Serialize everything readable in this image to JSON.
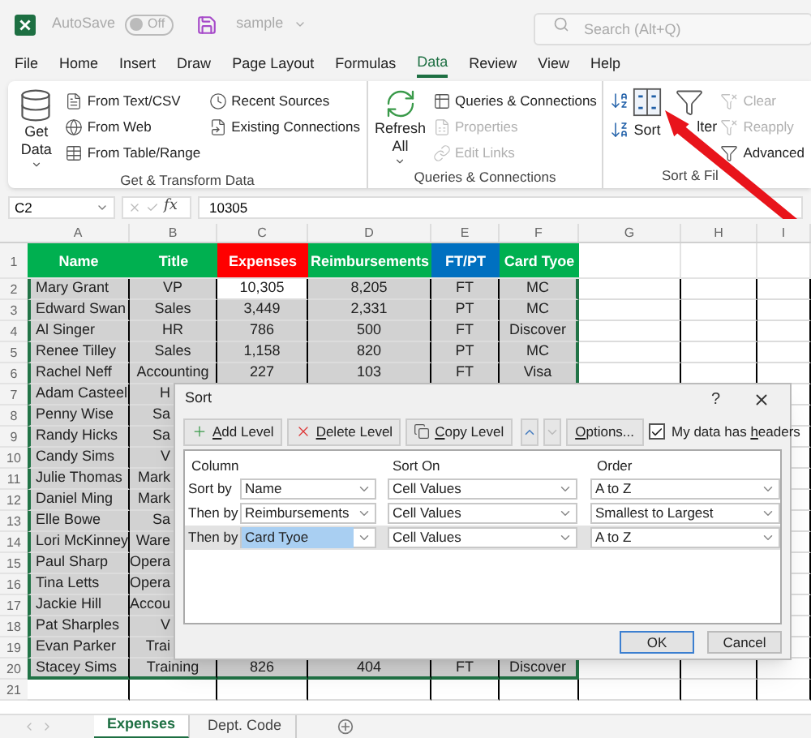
{
  "title_bar": {
    "autosave_label": "AutoSave",
    "autosave": {
      "label": "Off",
      "on": false
    },
    "file_name": "sample",
    "search": {
      "placeholder": "Search (Alt+Q)"
    }
  },
  "menu_tabs": [
    {
      "label": "File",
      "selected": false
    },
    {
      "label": "Home",
      "selected": false
    },
    {
      "label": "Insert",
      "selected": false
    },
    {
      "label": "Draw",
      "selected": false
    },
    {
      "label": "Page Layout",
      "selected": false
    },
    {
      "label": "Formulas",
      "selected": false
    },
    {
      "label": "Data",
      "selected": true
    },
    {
      "label": "Review",
      "selected": false
    },
    {
      "label": "View",
      "selected": false
    },
    {
      "label": "Help",
      "selected": false
    }
  ],
  "ribbon": {
    "groups": [
      {
        "kind": "get_transform",
        "label": "Get & Transform Data",
        "big_button": "Get Data",
        "items": [
          {
            "label": "From Text/CSV",
            "disabled": false
          },
          {
            "label": "From Web",
            "disabled": false
          },
          {
            "label": "From Table/Range",
            "disabled": false
          },
          {
            "label": "Recent Sources",
            "disabled": false
          },
          {
            "label": "Existing Connections",
            "disabled": false
          }
        ]
      },
      {
        "kind": "queries",
        "label": "Queries & Connections",
        "big_button": "Refresh All",
        "items": [
          {
            "label": "Queries & Connections",
            "disabled": false
          },
          {
            "label": "Properties",
            "disabled": true
          },
          {
            "label": "Edit Links",
            "disabled": true
          }
        ]
      },
      {
        "kind": "sort_filter",
        "label": "Sort & Fil",
        "big_buttons": [
          "Sort",
          "lter"
        ],
        "items": [
          {
            "label": "Clear",
            "disabled": true
          },
          {
            "label": "Reapply",
            "disabled": true
          },
          {
            "label": "Advanced",
            "disabled": false
          }
        ]
      }
    ]
  },
  "formula_bar": {
    "name_box": "C2",
    "function_label": "fx",
    "formula": "10305"
  },
  "sheet": {
    "columns": [
      "A",
      "B",
      "C",
      "D",
      "E",
      "F",
      "G",
      "H",
      "I"
    ],
    "header_row": {
      "number": "1",
      "cells": [
        {
          "text": "Name",
          "color": "#00b050"
        },
        {
          "text": "Title",
          "color": "#00b050"
        },
        {
          "text": "Expenses",
          "color": "#ff0000"
        },
        {
          "text": "Reimbursements",
          "color": "#00b050"
        },
        {
          "text": "FT/PT",
          "color": "#0070c0"
        },
        {
          "text": "Card Tyoe",
          "color": "#00b050"
        }
      ]
    },
    "rows": [
      {
        "number": "2",
        "cells": [
          {
            "text": "Mary Grant",
            "active": false
          },
          {
            "text": "VP",
            "active": false
          },
          {
            "text": "10,305",
            "active": true
          },
          {
            "text": "8,205",
            "active": false
          },
          {
            "text": "FT",
            "active": false
          },
          {
            "text": "MC",
            "active": false
          }
        ]
      },
      {
        "number": "3",
        "cells": [
          {
            "text": "Edward Swan",
            "active": false
          },
          {
            "text": "Sales",
            "active": false
          },
          {
            "text": "3,449",
            "active": false
          },
          {
            "text": "2,331",
            "active": false
          },
          {
            "text": "PT",
            "active": false
          },
          {
            "text": "MC",
            "active": false
          }
        ]
      },
      {
        "number": "4",
        "cells": [
          {
            "text": "Al Singer",
            "active": false
          },
          {
            "text": "HR",
            "active": false
          },
          {
            "text": "786",
            "active": false
          },
          {
            "text": "500",
            "active": false
          },
          {
            "text": "FT",
            "active": false
          },
          {
            "text": "Discover",
            "active": false
          }
        ]
      },
      {
        "number": "5",
        "cells": [
          {
            "text": "Renee Tilley",
            "active": false
          },
          {
            "text": "Sales",
            "active": false
          },
          {
            "text": "1,158",
            "active": false
          },
          {
            "text": "820",
            "active": false
          },
          {
            "text": "PT",
            "active": false
          },
          {
            "text": "MC",
            "active": false
          }
        ]
      },
      {
        "number": "6",
        "cells": [
          {
            "text": "Rachel Neff",
            "active": false
          },
          {
            "text": "Accounting",
            "active": false
          },
          {
            "text": "227",
            "active": false
          },
          {
            "text": "103",
            "active": false
          },
          {
            "text": "FT",
            "active": false
          },
          {
            "text": "Visa",
            "active": false
          }
        ]
      },
      {
        "number": "7",
        "cells": [
          {
            "text": "Adam Casteel",
            "active": false
          },
          {
            "text": "H",
            "active": false
          }
        ]
      },
      {
        "number": "8",
        "cells": [
          {
            "text": "Penny Wise",
            "active": false
          },
          {
            "text": "Sa",
            "active": false
          }
        ]
      },
      {
        "number": "9",
        "cells": [
          {
            "text": "Randy Hicks",
            "active": false
          },
          {
            "text": "Sa",
            "active": false
          }
        ]
      },
      {
        "number": "10",
        "cells": [
          {
            "text": "Candy Sims",
            "active": false
          },
          {
            "text": "V",
            "active": false
          }
        ]
      },
      {
        "number": "11",
        "cells": [
          {
            "text": "Julie Thomas",
            "active": false
          },
          {
            "text": "Mark",
            "active": false
          }
        ]
      },
      {
        "number": "12",
        "cells": [
          {
            "text": "Daniel Ming",
            "active": false
          },
          {
            "text": "Mark",
            "active": false
          }
        ]
      },
      {
        "number": "13",
        "cells": [
          {
            "text": "Elle Bowe",
            "active": false
          },
          {
            "text": "Sa",
            "active": false
          }
        ]
      },
      {
        "number": "14",
        "cells": [
          {
            "text": "Lori McKinney",
            "active": false
          },
          {
            "text": "Ware",
            "active": false
          }
        ]
      },
      {
        "number": "15",
        "cells": [
          {
            "text": "Paul Sharp",
            "active": false
          },
          {
            "text": "Opera",
            "active": false
          }
        ]
      },
      {
        "number": "16",
        "cells": [
          {
            "text": "Tina Letts",
            "active": false
          },
          {
            "text": "Opera",
            "active": false
          }
        ]
      },
      {
        "number": "17",
        "cells": [
          {
            "text": "Jackie Hill",
            "active": false
          },
          {
            "text": "Accou",
            "active": false
          }
        ]
      },
      {
        "number": "18",
        "cells": [
          {
            "text": "Pat Sharples",
            "active": false
          },
          {
            "text": "V",
            "active": false
          }
        ]
      },
      {
        "number": "19",
        "cells": [
          {
            "text": "Evan Parker",
            "active": false
          },
          {
            "text": "Trai",
            "active": false
          }
        ]
      },
      {
        "number": "20",
        "cells": [
          {
            "text": "Stacey Sims",
            "active": false
          },
          {
            "text": "Training",
            "active": false
          },
          {
            "text": "826",
            "active": false
          },
          {
            "text": "404",
            "active": false
          },
          {
            "text": "FT",
            "active": false
          },
          {
            "text": "Discover",
            "active": false
          }
        ]
      },
      {
        "number": "21",
        "cells": []
      }
    ]
  },
  "sheet_tabs": [
    {
      "label": "Expenses",
      "selected": true
    },
    {
      "label": "Dept. Code",
      "selected": false
    }
  ],
  "sort_dialog": {
    "title": "Sort",
    "help": "?",
    "toolbar": [
      {
        "access_key": "A",
        "rest": "dd Level"
      },
      {
        "access_key": "D",
        "rest": "elete Level"
      },
      {
        "access_key": "C",
        "rest": "opy Level"
      }
    ],
    "move_up": {
      "disabled": false
    },
    "move_down": {
      "disabled": true
    },
    "options": {
      "access_key": "O",
      "rest": "ptions..."
    },
    "headers_checkbox": {
      "lead": "My data has ",
      "access_key": "h",
      "rest": "eaders",
      "checked": true
    },
    "columns": [
      "Column",
      "Sort On",
      "Order"
    ],
    "levels": [
      {
        "label": "Sort by",
        "column": "Name",
        "sort_on": "Cell Values",
        "order": "A to Z",
        "selected": false
      },
      {
        "label": "Then by",
        "column": "Reimbursements",
        "sort_on": "Cell Values",
        "order": "Smallest to Largest",
        "selected": false
      },
      {
        "label": "Then by",
        "column": "Card Tyoe",
        "sort_on": "Cell Values",
        "order": "A to Z",
        "selected": true
      }
    ],
    "buttons": [
      "OK",
      "Cancel"
    ]
  }
}
